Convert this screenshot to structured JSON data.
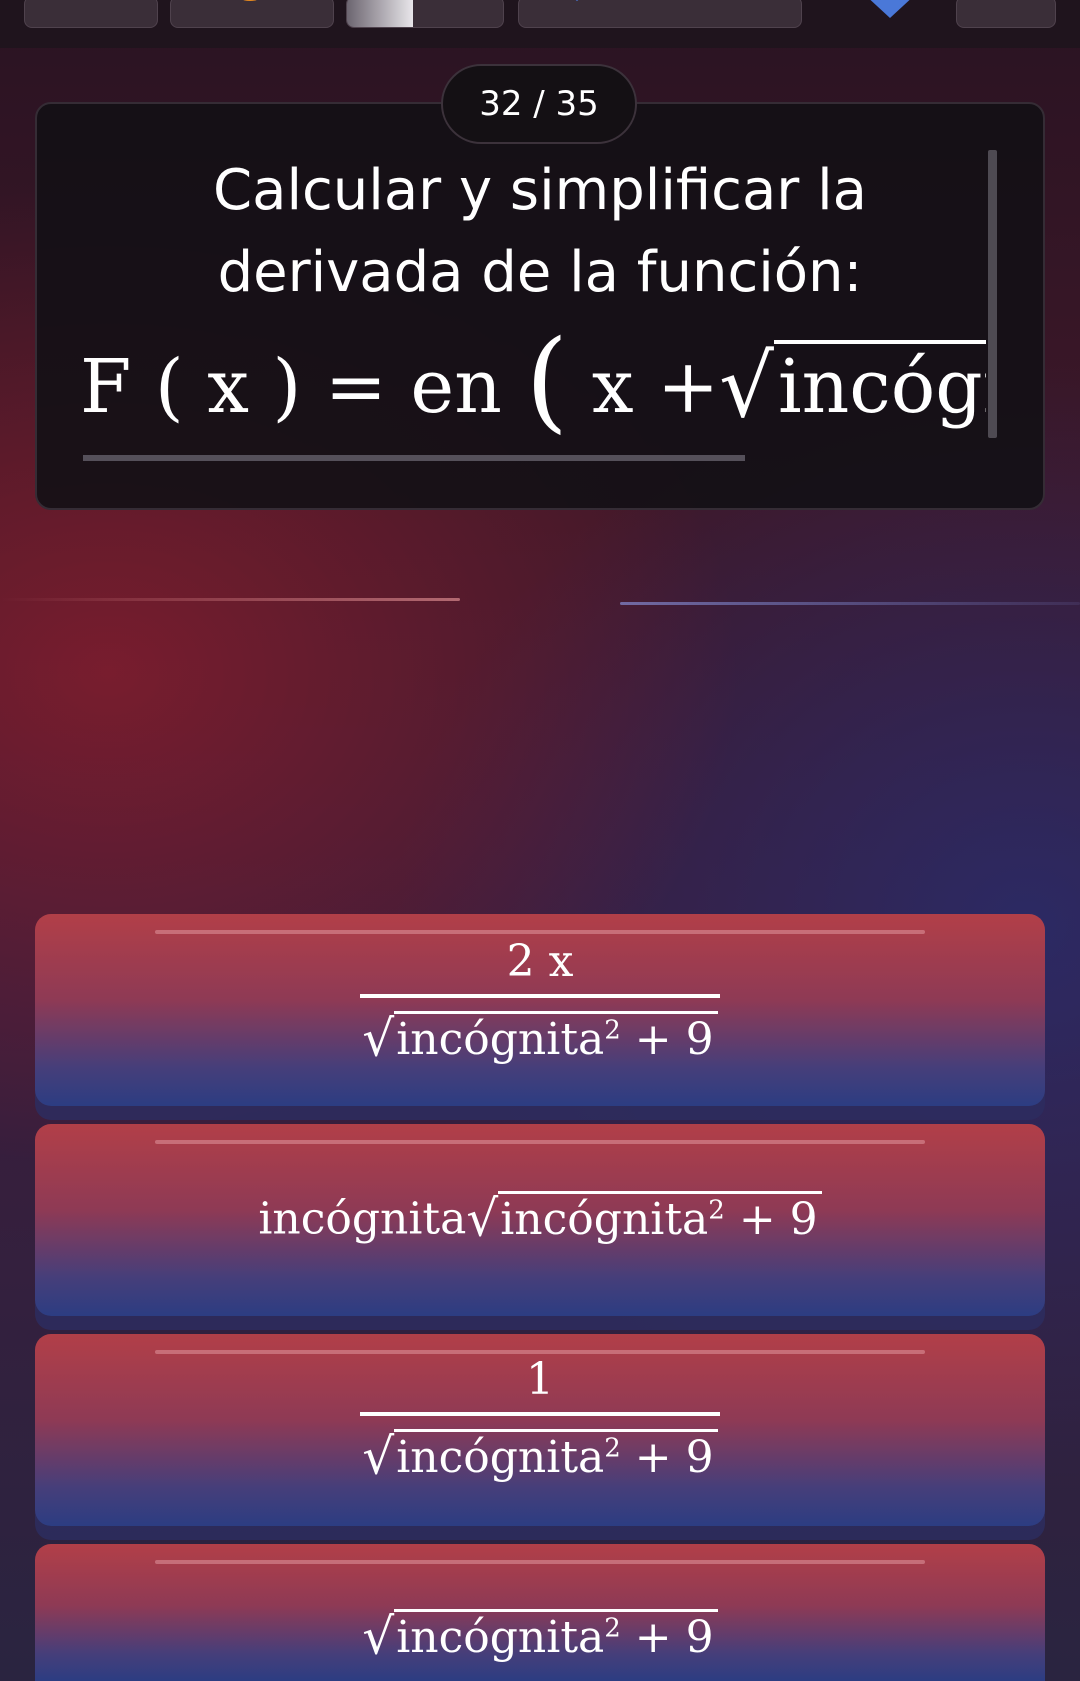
{
  "progress": {
    "counter": "32 / 35",
    "bar_fraction": 0.42
  },
  "question": {
    "line1": "Calcular y simplificar la",
    "line2": "derivada de la función:",
    "formula": {
      "lhs": "F ( x ) = en",
      "open_paren": "(",
      "x_plus": "x +",
      "sqrt_symbol": "√",
      "radicand_visible": "incógn"
    }
  },
  "answers": [
    {
      "type": "fraction",
      "numerator": "2 x",
      "radicand": "incógnita",
      "exponent": "2",
      "tail": " + 9"
    },
    {
      "type": "product",
      "prefix": "incógnita",
      "radicand": "incógnita",
      "exponent": "2",
      "tail": " + 9"
    },
    {
      "type": "fraction",
      "numerator": "1",
      "radicand": "incógnita",
      "exponent": "2",
      "tail": " + 9"
    },
    {
      "type": "sqrt",
      "radicand": "incógnita",
      "exponent": "2",
      "tail": " + 9"
    }
  ],
  "icons": {
    "sqrt_glyph": "√"
  },
  "colors": {
    "answer_top": "#b23f48",
    "answer_bottom": "#2c3d82",
    "card_bg": "#141016"
  }
}
